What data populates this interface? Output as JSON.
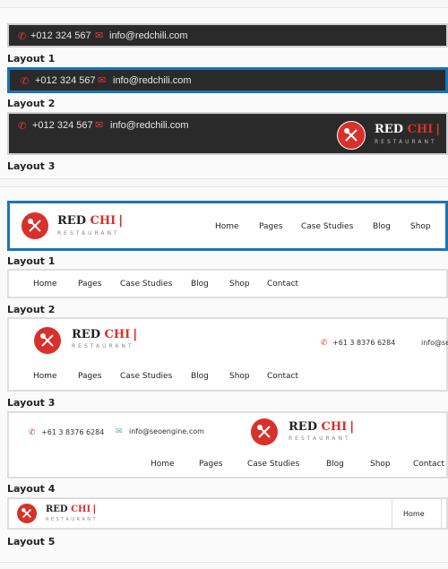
{
  "topbars": {
    "phone": "+012 324 567",
    "email": "info@redchili.com",
    "labels": [
      "Layout 1",
      "Layout 2",
      "Layout 3"
    ]
  },
  "brand": {
    "word1": "RED",
    "word2": "CHI",
    "glyph": "ı",
    "tagline": "RESTAURANT"
  },
  "nav": {
    "items_full": [
      "Home",
      "Pages",
      "Case Studies",
      "Blog",
      "Shop",
      "Contact"
    ]
  },
  "headers": {
    "labels": [
      "Layout 1",
      "Layout 2",
      "Layout 3",
      "Layout 4",
      "Layout 5"
    ],
    "phone2": "+61 3 8376 6284",
    "email2": "info@seoengine.com",
    "email2_cut": "info@seo"
  },
  "colors": {
    "accent": "#d8312b",
    "topbar_bg": "#2a2a2a",
    "highlight_border": "#1b74b8"
  }
}
